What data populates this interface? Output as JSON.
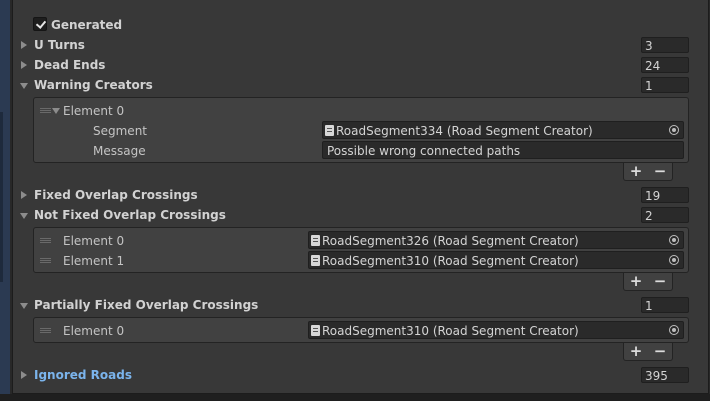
{
  "generated": {
    "label": "Generated",
    "checked": true
  },
  "u_turns": {
    "label": "U Turns",
    "value": "3"
  },
  "dead_ends": {
    "label": "Dead Ends",
    "value": "24"
  },
  "warning_creators": {
    "label": "Warning Creators",
    "count": "1",
    "elements": [
      {
        "label": "Element 0",
        "segment_label": "Segment",
        "segment_value": "RoadSegment334 (Road Segment Creator)",
        "message_label": "Message",
        "message_value": "Possible wrong connected paths"
      }
    ]
  },
  "fixed_overlap": {
    "label": "Fixed Overlap Crossings",
    "count": "19"
  },
  "not_fixed_overlap": {
    "label": "Not Fixed Overlap Crossings",
    "count": "2",
    "elements": [
      {
        "label": "Element 0",
        "value": "RoadSegment326 (Road Segment Creator)"
      },
      {
        "label": "Element 1",
        "value": "RoadSegment310 (Road Segment Creator)"
      }
    ]
  },
  "partially_fixed_overlap": {
    "label": "Partially Fixed Overlap Crossings",
    "count": "1",
    "elements": [
      {
        "label": "Element 0",
        "value": "RoadSegment310 (Road Segment Creator)"
      }
    ]
  },
  "ignored_roads": {
    "label": "Ignored Roads",
    "count": "395"
  },
  "list_controls": {
    "add": "+",
    "remove": "−"
  },
  "colors": {
    "panel": "#383838",
    "field": "#2a2a2a",
    "link": "#7bb4ec",
    "text": "#c4c4c4"
  },
  "icons": {
    "foldout_closed": "triangle-right-icon",
    "foldout_open": "triangle-down-icon",
    "object": "script-object-icon",
    "picker": "object-picker-icon",
    "drag": "drag-handle-icon"
  }
}
